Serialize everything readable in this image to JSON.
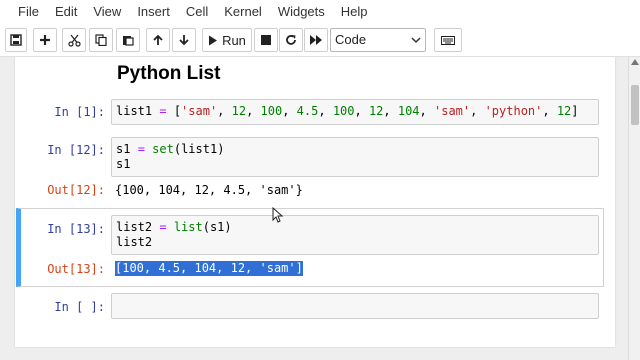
{
  "menu": [
    "File",
    "Edit",
    "View",
    "Insert",
    "Cell",
    "Kernel",
    "Widgets",
    "Help"
  ],
  "toolbar": {
    "run_label": "Run",
    "cell_type": "Code"
  },
  "notebook": {
    "heading": "Python List",
    "cells": [
      {
        "prompt": "In [1]:",
        "lines": [
          "list1 = ['sam', 12, 100, 4.5, 100, 12, 104, 'sam', 'python', 12]"
        ]
      },
      {
        "prompt": "In [12]:",
        "lines": [
          "s1 = set(list1)",
          "s1"
        ],
        "out_prompt": "Out[12]:",
        "output": "{100, 104, 12, 4.5, 'sam'}"
      },
      {
        "prompt": "In [13]:",
        "lines": [
          "list2 = list(s1)",
          "list2"
        ],
        "out_prompt": "Out[13]:",
        "output": "[100, 4.5, 104, 12, 'sam']",
        "selected": true
      },
      {
        "prompt": "In [ ]:",
        "lines": [
          ""
        ]
      }
    ]
  },
  "colors": {
    "prompt_in": "#303f9f",
    "prompt_out": "#d84315",
    "selected_border": "#42a5f5",
    "selection_highlight": "#2f6fd6"
  },
  "icons": [
    "save-icon",
    "plus-icon",
    "scissors-icon",
    "copy-icon",
    "paste-icon",
    "arrow-up-icon",
    "arrow-down-icon",
    "play-icon",
    "stop-icon",
    "restart-icon",
    "fast-forward-icon",
    "keyboard-icon"
  ]
}
